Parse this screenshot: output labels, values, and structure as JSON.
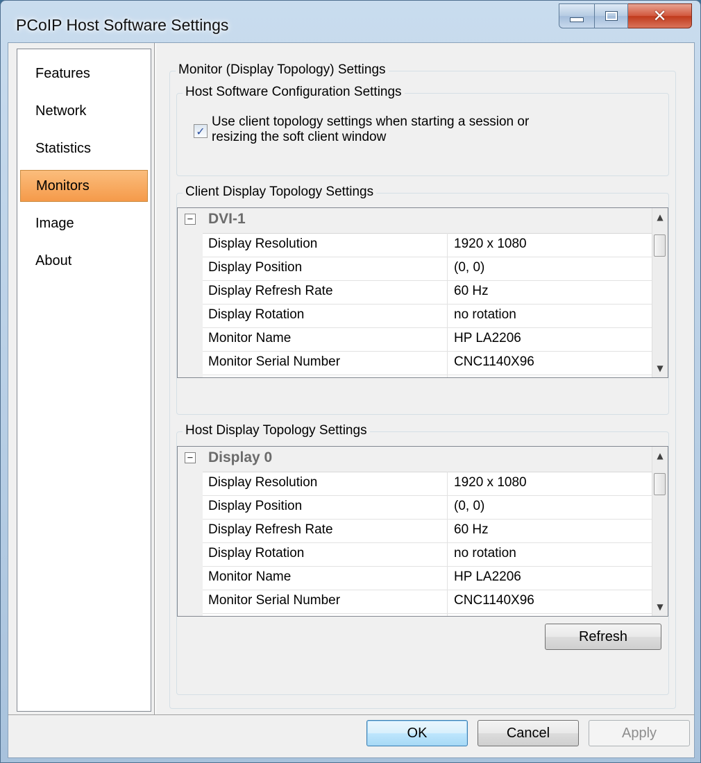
{
  "window": {
    "title": "PCoIP Host Software Settings"
  },
  "sidebar": {
    "items": [
      {
        "label": "Features"
      },
      {
        "label": "Network"
      },
      {
        "label": "Statistics"
      },
      {
        "label": "Monitors",
        "active": true
      },
      {
        "label": "Image"
      },
      {
        "label": "About"
      }
    ]
  },
  "main": {
    "outer_group_title": "Monitor (Display Topology) Settings",
    "host_config": {
      "title": "Host Software Configuration Settings",
      "checkbox_checked": true,
      "checkbox_line1": "Use client topology settings when starting a session or",
      "checkbox_line2": "resizing the soft client window"
    },
    "client_topology": {
      "title": "Client Display Topology Settings",
      "header": "DVI-1",
      "rows": [
        {
          "name": "Display Resolution",
          "value": "1920 x 1080"
        },
        {
          "name": "Display Position",
          "value": "(0, 0)"
        },
        {
          "name": "Display Refresh Rate",
          "value": "60 Hz"
        },
        {
          "name": "Display Rotation",
          "value": "no rotation"
        },
        {
          "name": "Monitor Name",
          "value": "HP LA2206"
        },
        {
          "name": "Monitor Serial Number",
          "value": "CNC1140X96"
        }
      ]
    },
    "host_topology": {
      "title": "Host Display Topology Settings",
      "header": "Display 0",
      "rows": [
        {
          "name": "Display Resolution",
          "value": "1920 x 1080"
        },
        {
          "name": "Display Position",
          "value": "(0, 0)"
        },
        {
          "name": "Display Refresh Rate",
          "value": "60 Hz"
        },
        {
          "name": "Display Rotation",
          "value": "no rotation"
        },
        {
          "name": "Monitor Name",
          "value": "HP LA2206"
        },
        {
          "name": "Monitor Serial Number",
          "value": "CNC1140X96"
        }
      ]
    },
    "refresh_label": "Refresh"
  },
  "footer": {
    "ok_label": "OK",
    "cancel_label": "Cancel",
    "apply_label": "Apply"
  },
  "colors": {
    "active_nav": "#f59a4a",
    "close_button": "#c03a1c",
    "checkbox_check": "#2c50a0"
  }
}
